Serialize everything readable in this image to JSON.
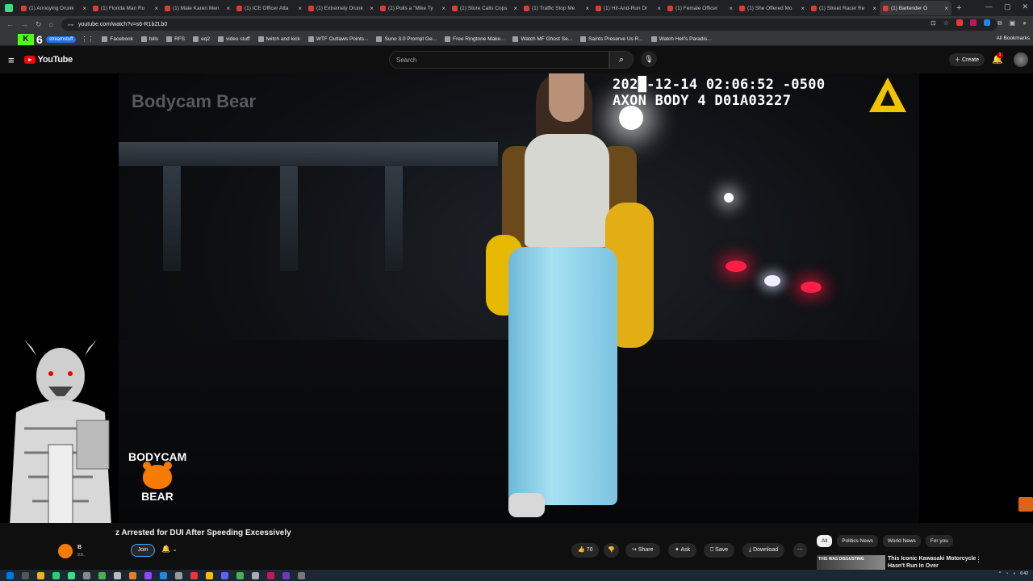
{
  "browser": {
    "tabs": [
      {
        "title": "(1) Annoying Drunk"
      },
      {
        "title": "(1) Florida Man Ru"
      },
      {
        "title": "(1) Male Karen Men"
      },
      {
        "title": "(1) ICE Officer Atta"
      },
      {
        "title": "(1) Extremely Drunk"
      },
      {
        "title": "(1) Pulls a \"Mike Ty"
      },
      {
        "title": "(1) Store Calls Cops"
      },
      {
        "title": "(1) Traffic Stop Me"
      },
      {
        "title": "(1) Hit-And-Run Dr"
      },
      {
        "title": "(1) Female Officer"
      },
      {
        "title": "(1) She Offered Mo"
      },
      {
        "title": "(1) Street Racer Re"
      },
      {
        "title": "(1) Bartender G"
      }
    ],
    "url": "youtube.com/watch?v=s6-R1bZLb0",
    "bookmarks": {
      "chip": "streamstuff",
      "six": "6",
      "items": [
        "Facebook",
        "bills",
        "RFS",
        "eq2",
        "video stuff",
        "twitch and kick",
        "WTF Outlaws Points...",
        "Suno 3.0 Prompt Ge...",
        "Free Ringtone Make...",
        "Watch MF Ghost Se...",
        "Saints Preserve Us R...",
        "Watch Hell's Paradis..."
      ],
      "all": "All Bookmarks"
    }
  },
  "youtube": {
    "logo_text": "YouTube",
    "search_placeholder": "Search",
    "create_label": "Create",
    "notif_count": "1",
    "colors": {
      "brand": "#ff0000",
      "background": "#0f0f0f"
    }
  },
  "video": {
    "timestamp_line1": "202█-12-14 02:06:52 -0500",
    "timestamp_line2": "AXON BODY 4 D01A03227",
    "watermark": "Bodycam Bear",
    "logo_line1": "BODYCAM",
    "logo_line2": "BEAR"
  },
  "below": {
    "title": "z Arrested for DUI After Speeding Excessively",
    "channel_name": "B",
    "channel_subs": "9.8..",
    "join_label": "Join",
    "like_count": "70",
    "share_label": "Share",
    "ask_label": "Ask",
    "save_label": "Save",
    "download_label": "Download",
    "chips": [
      "All",
      "Politics News",
      "World News",
      "For you"
    ],
    "rec_thumb_text": "THIS WAS DISGUSTING",
    "rec_title": "This Iconic Kawasaki Motorcycle Hasn't Run In Over"
  },
  "taskbar": {
    "time": "6:42"
  }
}
